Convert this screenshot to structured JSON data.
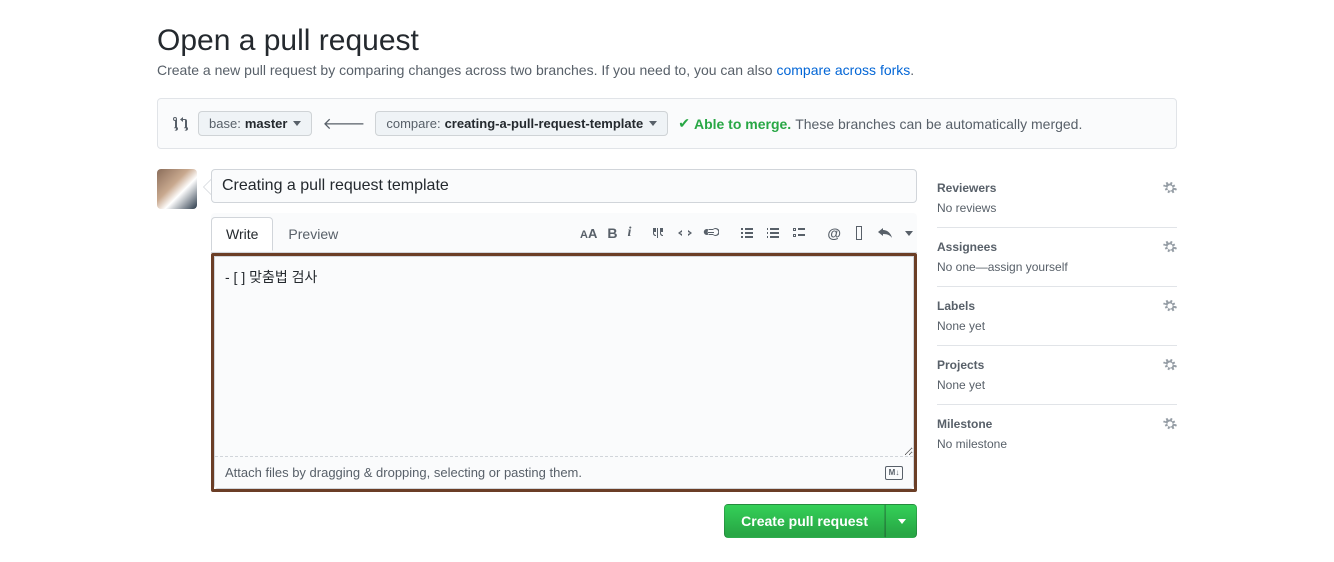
{
  "header": {
    "title": "Open a pull request",
    "subtitle_before": "Create a new pull request by comparing changes across two branches. If you need to, you can also ",
    "subtitle_link": "compare across forks",
    "subtitle_after": "."
  },
  "compare": {
    "base_prefix": "base: ",
    "base_branch": "master",
    "compare_prefix": "compare: ",
    "compare_branch": "creating-a-pull-request-template",
    "merge_able": "Able to merge.",
    "merge_rest": " These branches can be automatically merged."
  },
  "form": {
    "title_value": "Creating a pull request template",
    "tabs": {
      "write": "Write",
      "preview": "Preview"
    },
    "body_value": "- [ ] 맞춤법 검사",
    "attach_hint": "Attach files by dragging & dropping, selecting or pasting them.",
    "submit_label": "Create pull request"
  },
  "sidebar": {
    "reviewers": {
      "title": "Reviewers",
      "value": "No reviews"
    },
    "assignees": {
      "title": "Assignees",
      "value": "No one—assign yourself"
    },
    "labels": {
      "title": "Labels",
      "value": "None yet"
    },
    "projects": {
      "title": "Projects",
      "value": "None yet"
    },
    "milestone": {
      "title": "Milestone",
      "value": "No milestone"
    }
  }
}
